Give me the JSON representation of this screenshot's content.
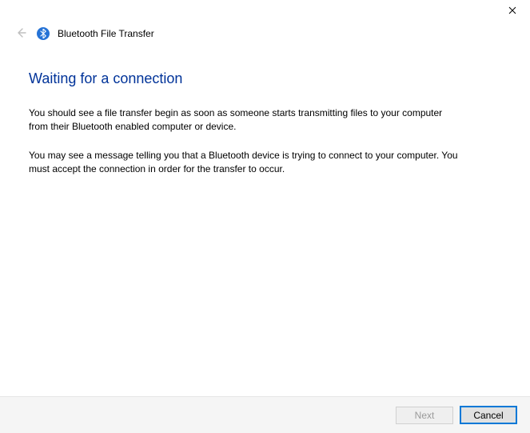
{
  "window": {
    "title": "Bluetooth File Transfer"
  },
  "page": {
    "heading": "Waiting for a connection",
    "paragraph1": "You should see a file transfer begin as soon as someone starts transmitting files to your computer from their Bluetooth enabled computer or device.",
    "paragraph2": "You may see a message telling you that a Bluetooth device is trying to connect to your computer. You must accept the connection in order for the transfer to occur."
  },
  "footer": {
    "next_label": "Next",
    "cancel_label": "Cancel"
  },
  "icons": {
    "bluetooth": "bluetooth-icon",
    "back": "back-arrow-icon",
    "close": "close-icon"
  },
  "colors": {
    "heading": "#003399",
    "accent": "#0078d7",
    "bt_blue": "#2673d6"
  }
}
